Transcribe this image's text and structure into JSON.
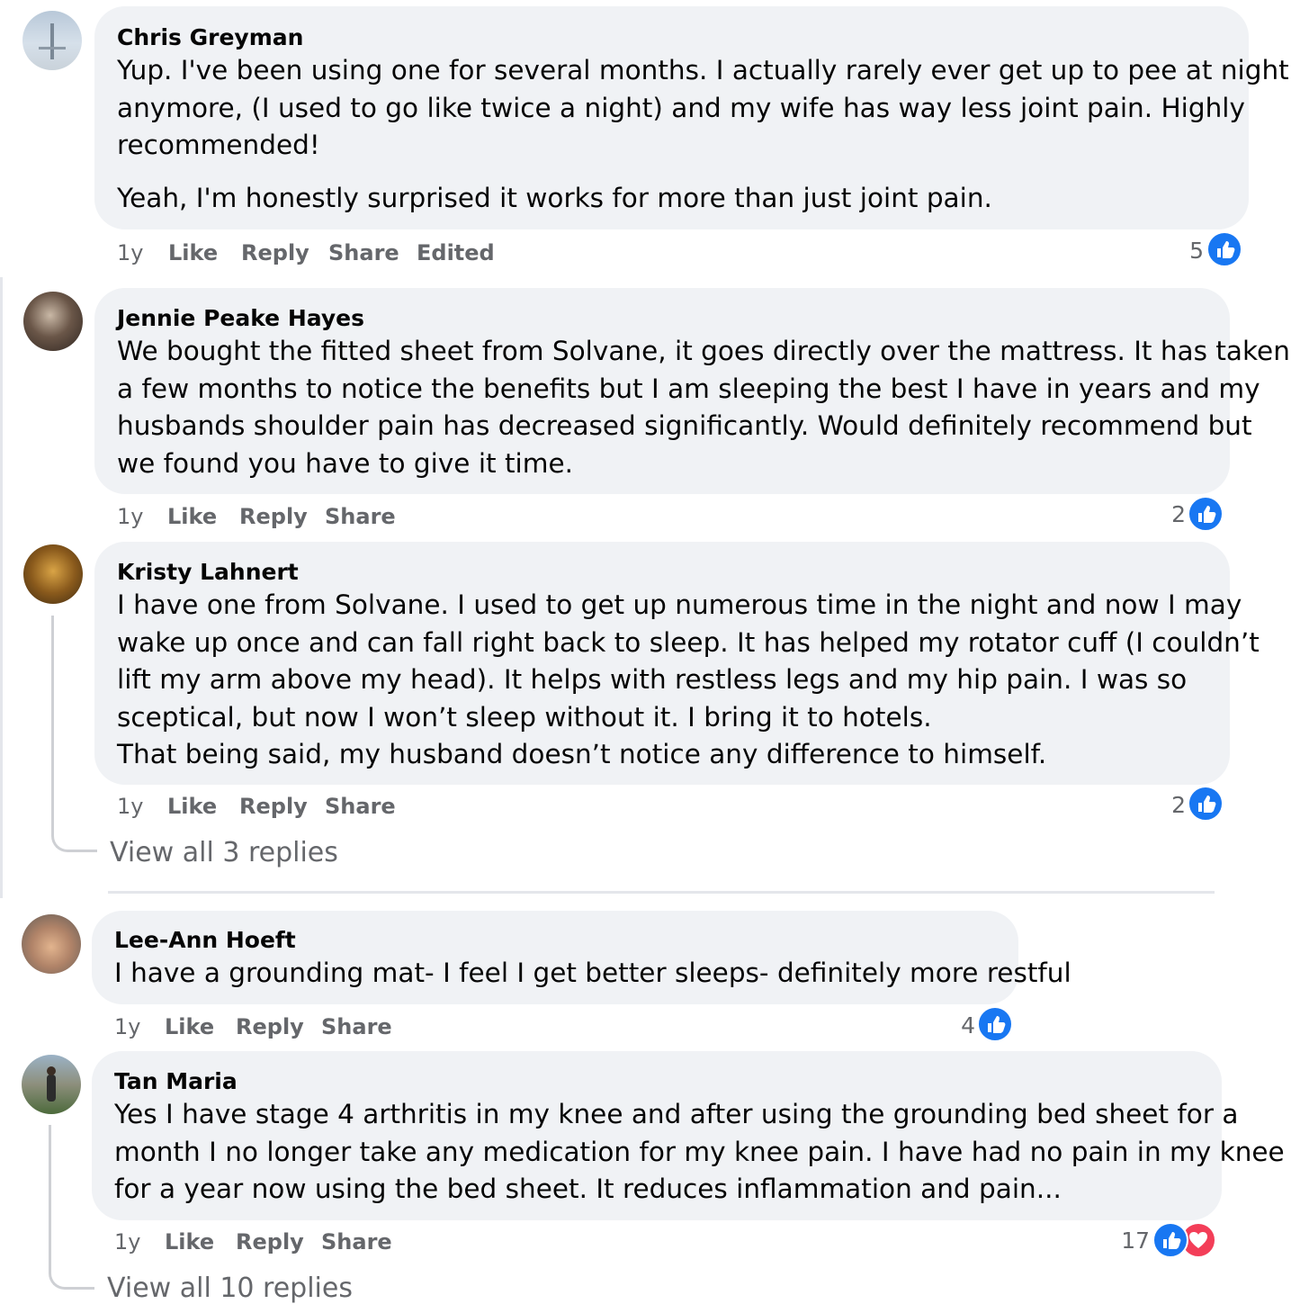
{
  "comments": [
    {
      "author": "Chris Greyman",
      "lines": [
        "Yup. I've been using one for several months. I actually rarely ever get up to pee at night",
        "anymore, (I used to go like twice a night) and my wife has way less joint pain. Highly",
        "recommended!"
      ],
      "extra": "Yeah, I'm honestly surprised it works for more than just joint pain.",
      "time": "1y",
      "like": "Like",
      "reply": "Reply",
      "share": "Share",
      "edited": "Edited",
      "reaction_count": "5",
      "reactions": [
        "like-icon"
      ]
    },
    {
      "author": "Jennie Peake Hayes",
      "lines": [
        "We bought the fitted sheet from Solvane, it goes directly over the mattress. It has taken",
        "a few months to notice the benefits but I am sleeping the best I have in years and my",
        "husbands shoulder pain has decreased significantly. Would definitely recommend but",
        "we found you have to give it time."
      ],
      "time": "1y",
      "like": "Like",
      "reply": "Reply",
      "share": "Share",
      "reaction_count": "2",
      "reactions": [
        "like-icon"
      ]
    },
    {
      "author": "Kristy Lahnert",
      "lines": [
        "I have one from Solvane. I used to get up numerous time in the night and now I may",
        "wake up once and can fall right back to sleep. It has helped my rotator cuff (I couldn’t",
        "lift my arm above my head). It helps with restless legs and my hip pain. I was so",
        "sceptical, but now I won’t sleep without it. I bring it to hotels.",
        "That being said, my husband doesn’t notice any difference to himself."
      ],
      "time": "1y",
      "like": "Like",
      "reply": "Reply",
      "share": "Share",
      "reaction_count": "2",
      "reactions": [
        "like-icon"
      ],
      "view_replies": "View all 3 replies"
    },
    {
      "author": "Lee-Ann Hoeft",
      "lines": [
        "I have a grounding mat- I feel I get better sleeps- definitely more restful"
      ],
      "time": "1y",
      "like": "Like",
      "reply": "Reply",
      "share": "Share",
      "reaction_count": "4",
      "reactions": [
        "like-icon"
      ]
    },
    {
      "author": "Tan Maria",
      "lines": [
        "Yes I have stage 4 arthritis in my knee and after using the grounding bed sheet for a",
        "month I no longer take any medication for my knee pain. I have had no pain in my knee",
        "for a year now using the bed sheet. It reduces inflammation and pain..."
      ],
      "time": "1y",
      "like": "Like",
      "reply": "Reply",
      "share": "Share",
      "reaction_count": "17",
      "reactions": [
        "like-icon",
        "love-icon"
      ],
      "view_replies": "View all 10 replies"
    }
  ],
  "colors": {
    "bubble": "#f0f2f5",
    "meta_text": "#65676b",
    "like_blue": "#1877f2",
    "love_red": "#f33e58"
  }
}
